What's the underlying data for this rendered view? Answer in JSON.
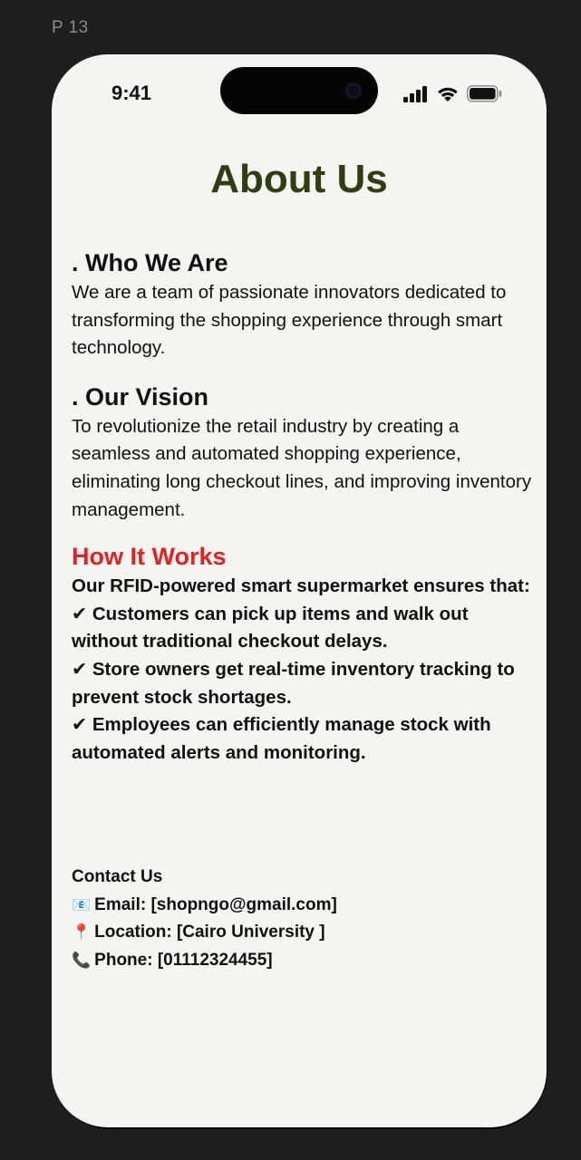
{
  "frame_label": "P 13",
  "status_bar": {
    "time": "9:41",
    "icons": [
      "signal-icon",
      "wifi-icon",
      "battery-icon"
    ]
  },
  "page_title": "About Us",
  "who_we_are": {
    "heading": ". Who We Are",
    "body": "We are a team of passionate innovators dedicated to transforming the shopping experience through smart technology."
  },
  "our_vision": {
    "heading": ". Our Vision",
    "body": "To revolutionize the retail industry by creating a seamless and automated shopping experience, eliminating long checkout lines, and improving inventory management."
  },
  "how_it_works": {
    "heading": "How It Works",
    "intro": "Our RFID-powered smart supermarket ensures that:",
    "points": [
      "✔ Customers can pick up items and walk out without traditional checkout delays.",
      "✔ Store owners get real-time inventory tracking to prevent stock shortages.",
      "✔ Employees can efficiently manage stock with automated alerts and monitoring."
    ]
  },
  "contact": {
    "heading": "Contact Us",
    "email_icon": "📧",
    "email": "Email: [shopngo@gmail.com]",
    "location_icon": "📍",
    "location": "Location: [Cairo University ]",
    "phone_icon": "📞",
    "phone": "Phone: [01112324455]"
  },
  "colors": {
    "background": "#1e1e1e",
    "screen": "#f4f4f1",
    "title": "#2e3d12",
    "accent_red": "#e02424",
    "text": "#111111"
  }
}
